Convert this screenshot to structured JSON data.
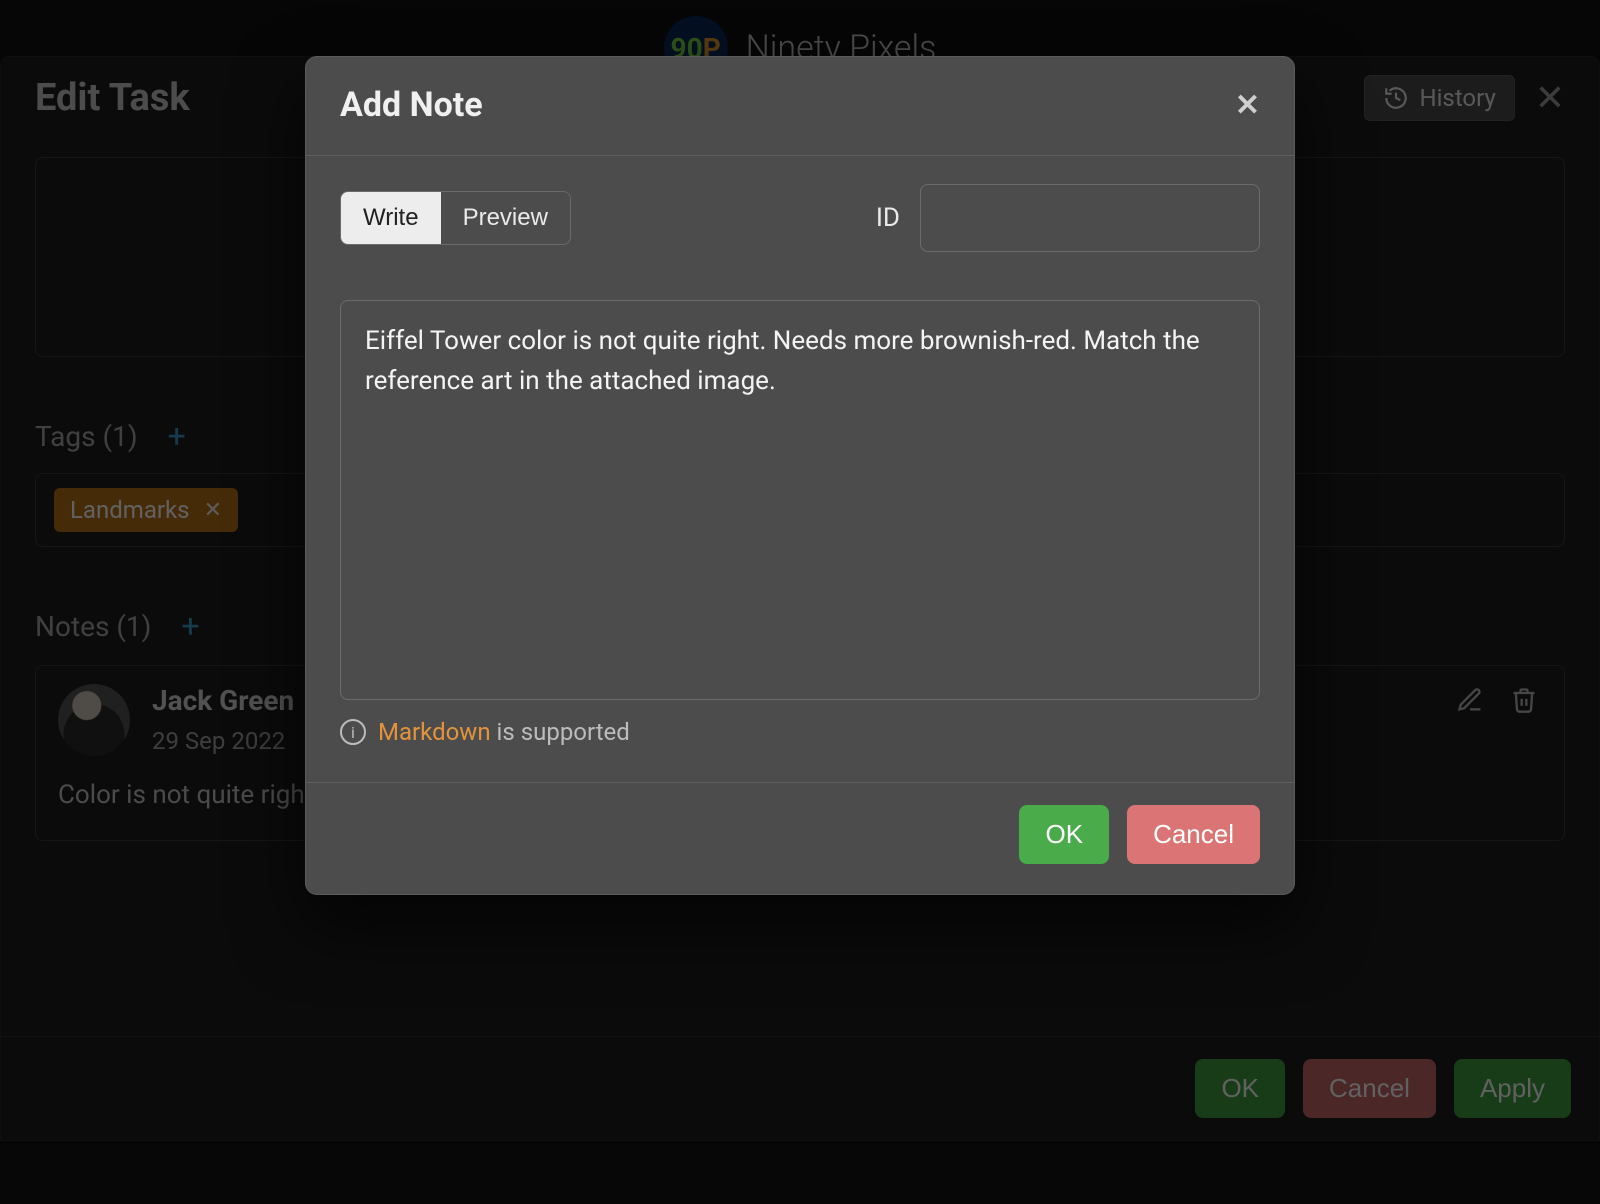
{
  "app": {
    "brand_short": "90",
    "brand_short_suffix": "P",
    "brand_name": "Ninety Pixels"
  },
  "edit_panel": {
    "title": "Edit Task",
    "history_button": "History",
    "tags_label": "Tags (1)",
    "notes_label": "Notes (1)",
    "tag": "Landmarks",
    "note": {
      "author": "Jack Green",
      "date": "29 Sep 2022",
      "text": "Color is not quite right"
    },
    "buttons": {
      "ok": "OK",
      "cancel": "Cancel",
      "apply": "Apply"
    }
  },
  "modal": {
    "title": "Add Note",
    "tabs": {
      "write": "Write",
      "preview": "Preview"
    },
    "id_label": "ID",
    "id_value": "",
    "note_text": "Eiffel Tower color is not quite right. Needs more brownish-red. Match the reference art in the attached image.",
    "markdown_link": "Markdown",
    "markdown_support": " is supported",
    "buttons": {
      "ok": "OK",
      "cancel": "Cancel"
    }
  }
}
